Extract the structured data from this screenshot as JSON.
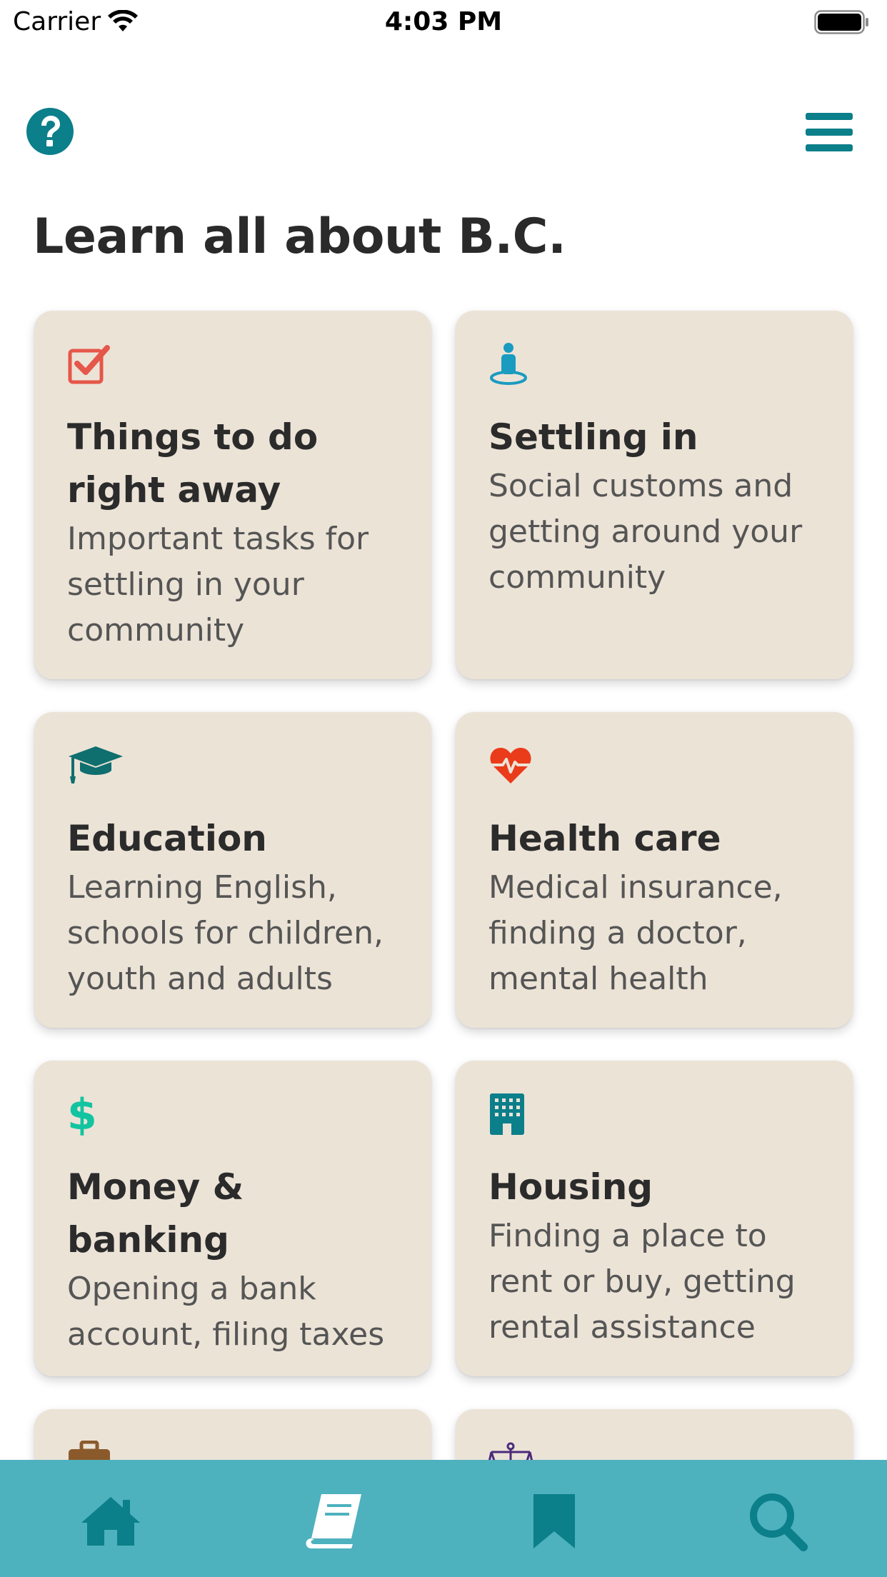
{
  "status_bar": {
    "carrier": "Carrier",
    "time": "4:03 PM"
  },
  "header": {
    "title": "Learn all about B.C."
  },
  "cards": [
    {
      "icon": "checkbox-icon",
      "title": "Things to do right away",
      "description": "Important tasks for settling in your community"
    },
    {
      "icon": "person-on-location-icon",
      "title": "Settling in",
      "description": "Social customs and getting around your community"
    },
    {
      "icon": "graduation-cap-icon",
      "title": "Education",
      "description": "Learning English, schools for children, youth and adults"
    },
    {
      "icon": "heartbeat-icon",
      "title": "Health care",
      "description": "Medical insurance, finding a doctor, mental health"
    },
    {
      "icon": "dollar-icon",
      "title": "Money & banking",
      "description": "Opening a bank account, filing taxes"
    },
    {
      "icon": "building-icon",
      "title": "Housing",
      "description": "Finding a place to rent or buy, getting rental assistance"
    },
    {
      "icon": "briefcase-icon",
      "title": "",
      "description": ""
    },
    {
      "icon": "scales-icon",
      "title": "",
      "description": ""
    }
  ],
  "colors": {
    "accent_teal": "#0b7f8a",
    "card_background": "#ece3d7",
    "tab_bar": "#4eb1be",
    "checkbox_red": "#e5574a",
    "person_blue": "#1a9bc0",
    "cap_teal": "#0f6e6e",
    "heart_red": "#ea3b1b",
    "dollar_green": "#12c4a0",
    "building_teal": "#0b7f8a",
    "briefcase_brown": "#8b5a2b",
    "scales_purple": "#4b2a7b"
  },
  "tab_bar": {
    "tabs": [
      {
        "icon": "home-icon",
        "active": false
      },
      {
        "icon": "book-icon",
        "active": true
      },
      {
        "icon": "bookmark-icon",
        "active": false
      },
      {
        "icon": "search-icon",
        "active": false
      }
    ]
  }
}
